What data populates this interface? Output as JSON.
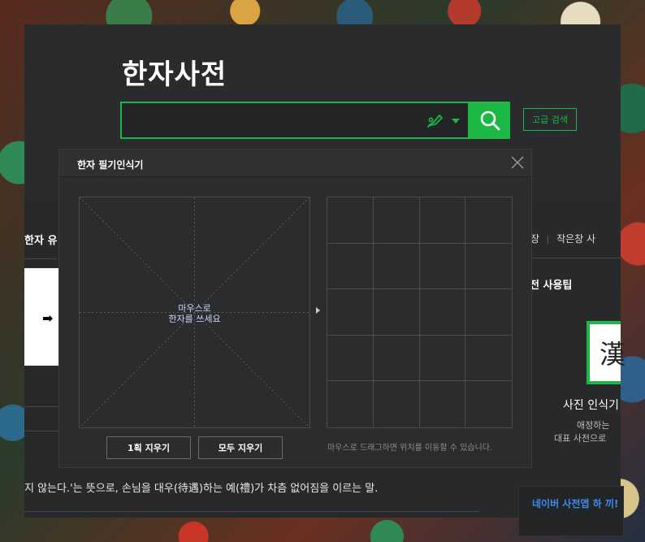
{
  "app": {
    "title": "한자사전",
    "search_placeholder": "",
    "advanced_search_label": "고급 검색"
  },
  "left": {
    "tab_label": "한자 유",
    "meaning_text": "지 않는다.'는 뜻으로, 손님을 대우(待遇)하는 예(禮)가 차츰 없어짐을 이르는 말."
  },
  "right": {
    "links": [
      "저장",
      "작은창 사"
    ],
    "tips_title": "전 사용팁",
    "photo_glyph": "漢",
    "photo_label": "사진 인식기",
    "photo_desc_1": "애정하는",
    "photo_desc_2": "대표 사전으로",
    "app_promo": "네이버 사전앱 하 끼!"
  },
  "modal": {
    "title": "한자 필기인식기",
    "draw_hint_1": "마우스로",
    "draw_hint_2": "한자를 쓰세요",
    "undo_label": "1획 지우기",
    "clear_label": "모두 지우기",
    "note": "마우스로 드래그하면 위치를 이동할 수 있습니다."
  },
  "colors": {
    "accent": "#1bb845",
    "background": "#28292b",
    "promo_link": "#3b8cf0"
  },
  "icons": {
    "search": "magnifier-icon",
    "handwrite": "pen-icon",
    "close": "x-icon"
  }
}
